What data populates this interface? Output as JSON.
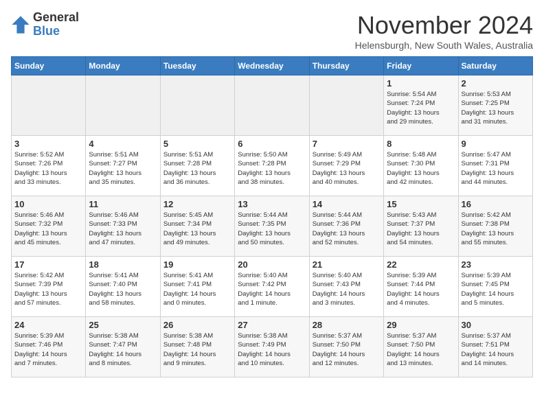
{
  "logo": {
    "general": "General",
    "blue": "Blue"
  },
  "title": "November 2024",
  "subtitle": "Helensburgh, New South Wales, Australia",
  "days_header": [
    "Sunday",
    "Monday",
    "Tuesday",
    "Wednesday",
    "Thursday",
    "Friday",
    "Saturday"
  ],
  "weeks": [
    [
      {
        "day": "",
        "info": ""
      },
      {
        "day": "",
        "info": ""
      },
      {
        "day": "",
        "info": ""
      },
      {
        "day": "",
        "info": ""
      },
      {
        "day": "",
        "info": ""
      },
      {
        "day": "1",
        "info": "Sunrise: 5:54 AM\nSunset: 7:24 PM\nDaylight: 13 hours\nand 29 minutes."
      },
      {
        "day": "2",
        "info": "Sunrise: 5:53 AM\nSunset: 7:25 PM\nDaylight: 13 hours\nand 31 minutes."
      }
    ],
    [
      {
        "day": "3",
        "info": "Sunrise: 5:52 AM\nSunset: 7:26 PM\nDaylight: 13 hours\nand 33 minutes."
      },
      {
        "day": "4",
        "info": "Sunrise: 5:51 AM\nSunset: 7:27 PM\nDaylight: 13 hours\nand 35 minutes."
      },
      {
        "day": "5",
        "info": "Sunrise: 5:51 AM\nSunset: 7:28 PM\nDaylight: 13 hours\nand 36 minutes."
      },
      {
        "day": "6",
        "info": "Sunrise: 5:50 AM\nSunset: 7:28 PM\nDaylight: 13 hours\nand 38 minutes."
      },
      {
        "day": "7",
        "info": "Sunrise: 5:49 AM\nSunset: 7:29 PM\nDaylight: 13 hours\nand 40 minutes."
      },
      {
        "day": "8",
        "info": "Sunrise: 5:48 AM\nSunset: 7:30 PM\nDaylight: 13 hours\nand 42 minutes."
      },
      {
        "day": "9",
        "info": "Sunrise: 5:47 AM\nSunset: 7:31 PM\nDaylight: 13 hours\nand 44 minutes."
      }
    ],
    [
      {
        "day": "10",
        "info": "Sunrise: 5:46 AM\nSunset: 7:32 PM\nDaylight: 13 hours\nand 45 minutes."
      },
      {
        "day": "11",
        "info": "Sunrise: 5:46 AM\nSunset: 7:33 PM\nDaylight: 13 hours\nand 47 minutes."
      },
      {
        "day": "12",
        "info": "Sunrise: 5:45 AM\nSunset: 7:34 PM\nDaylight: 13 hours\nand 49 minutes."
      },
      {
        "day": "13",
        "info": "Sunrise: 5:44 AM\nSunset: 7:35 PM\nDaylight: 13 hours\nand 50 minutes."
      },
      {
        "day": "14",
        "info": "Sunrise: 5:44 AM\nSunset: 7:36 PM\nDaylight: 13 hours\nand 52 minutes."
      },
      {
        "day": "15",
        "info": "Sunrise: 5:43 AM\nSunset: 7:37 PM\nDaylight: 13 hours\nand 54 minutes."
      },
      {
        "day": "16",
        "info": "Sunrise: 5:42 AM\nSunset: 7:38 PM\nDaylight: 13 hours\nand 55 minutes."
      }
    ],
    [
      {
        "day": "17",
        "info": "Sunrise: 5:42 AM\nSunset: 7:39 PM\nDaylight: 13 hours\nand 57 minutes."
      },
      {
        "day": "18",
        "info": "Sunrise: 5:41 AM\nSunset: 7:40 PM\nDaylight: 13 hours\nand 58 minutes."
      },
      {
        "day": "19",
        "info": "Sunrise: 5:41 AM\nSunset: 7:41 PM\nDaylight: 14 hours\nand 0 minutes."
      },
      {
        "day": "20",
        "info": "Sunrise: 5:40 AM\nSunset: 7:42 PM\nDaylight: 14 hours\nand 1 minute."
      },
      {
        "day": "21",
        "info": "Sunrise: 5:40 AM\nSunset: 7:43 PM\nDaylight: 14 hours\nand 3 minutes."
      },
      {
        "day": "22",
        "info": "Sunrise: 5:39 AM\nSunset: 7:44 PM\nDaylight: 14 hours\nand 4 minutes."
      },
      {
        "day": "23",
        "info": "Sunrise: 5:39 AM\nSunset: 7:45 PM\nDaylight: 14 hours\nand 5 minutes."
      }
    ],
    [
      {
        "day": "24",
        "info": "Sunrise: 5:39 AM\nSunset: 7:46 PM\nDaylight: 14 hours\nand 7 minutes."
      },
      {
        "day": "25",
        "info": "Sunrise: 5:38 AM\nSunset: 7:47 PM\nDaylight: 14 hours\nand 8 minutes."
      },
      {
        "day": "26",
        "info": "Sunrise: 5:38 AM\nSunset: 7:48 PM\nDaylight: 14 hours\nand 9 minutes."
      },
      {
        "day": "27",
        "info": "Sunrise: 5:38 AM\nSunset: 7:49 PM\nDaylight: 14 hours\nand 10 minutes."
      },
      {
        "day": "28",
        "info": "Sunrise: 5:37 AM\nSunset: 7:50 PM\nDaylight: 14 hours\nand 12 minutes."
      },
      {
        "day": "29",
        "info": "Sunrise: 5:37 AM\nSunset: 7:50 PM\nDaylight: 14 hours\nand 13 minutes."
      },
      {
        "day": "30",
        "info": "Sunrise: 5:37 AM\nSunset: 7:51 PM\nDaylight: 14 hours\nand 14 minutes."
      }
    ]
  ]
}
